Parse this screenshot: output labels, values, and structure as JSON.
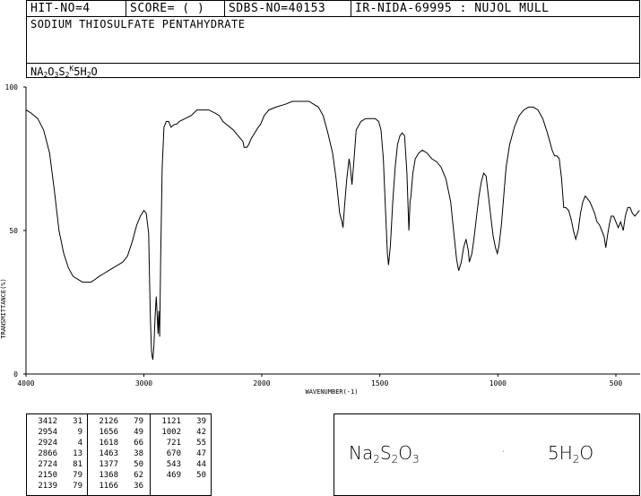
{
  "header": {
    "hit_no": "HIT-NO=4",
    "score": "SCORE=  (   )",
    "sdbs_no": "SDBS-NO=40153",
    "ir_nida": "IR-NIDA-69995 : NUJOL MULL",
    "compound_name": "SODIUM THIOSULFATE PENTAHYDRATE",
    "formula_parts": [
      "NA",
      "2",
      "O",
      "3",
      "S",
      "2",
      "K",
      "5H",
      "2",
      "O"
    ]
  },
  "chart_data": {
    "type": "line",
    "title": "",
    "xlabel": "WAVENUMBER(-1)",
    "ylabel": "TRANSMITTANCE(%)",
    "xlim": [
      4000,
      400
    ],
    "ylim": [
      0,
      100
    ],
    "x_ticks": [
      "4000",
      "3000",
      "2000",
      "1500",
      "1000",
      "500"
    ],
    "x_tick_values": [
      4000,
      3000,
      2000,
      1500,
      1000,
      500
    ],
    "y_ticks": [
      "0",
      "50",
      "100"
    ],
    "y_tick_values": [
      0,
      50,
      100
    ],
    "series": [
      {
        "points": [
          [
            4000,
            92
          ],
          [
            3960,
            91
          ],
          [
            3900,
            89
          ],
          [
            3850,
            85
          ],
          [
            3800,
            77
          ],
          [
            3760,
            64
          ],
          [
            3720,
            50
          ],
          [
            3680,
            42
          ],
          [
            3640,
            37
          ],
          [
            3600,
            34
          ],
          [
            3560,
            33
          ],
          [
            3520,
            32
          ],
          [
            3480,
            32
          ],
          [
            3450,
            32
          ],
          [
            3412,
            33
          ],
          [
            3380,
            34
          ],
          [
            3340,
            35
          ],
          [
            3300,
            36
          ],
          [
            3260,
            37
          ],
          [
            3220,
            38
          ],
          [
            3180,
            39
          ],
          [
            3140,
            41
          ],
          [
            3100,
            46
          ],
          [
            3060,
            52
          ],
          [
            3030,
            55
          ],
          [
            3000,
            57
          ],
          [
            2980,
            56
          ],
          [
            2960,
            49
          ],
          [
            2954,
            38
          ],
          [
            2945,
            20
          ],
          [
            2935,
            8
          ],
          [
            2929,
            6
          ],
          [
            2924,
            5
          ],
          [
            2915,
            10
          ],
          [
            2905,
            20
          ],
          [
            2895,
            27
          ],
          [
            2887,
            20
          ],
          [
            2880,
            14
          ],
          [
            2874,
            22
          ],
          [
            2866,
            13
          ],
          [
            2858,
            40
          ],
          [
            2845,
            72
          ],
          [
            2830,
            86
          ],
          [
            2810,
            88
          ],
          [
            2790,
            88
          ],
          [
            2770,
            86
          ],
          [
            2740,
            87
          ],
          [
            2724,
            87
          ],
          [
            2700,
            88
          ],
          [
            2650,
            89
          ],
          [
            2600,
            90
          ],
          [
            2550,
            92
          ],
          [
            2500,
            92
          ],
          [
            2450,
            92
          ],
          [
            2400,
            91
          ],
          [
            2360,
            90
          ],
          [
            2330,
            88
          ],
          [
            2300,
            87
          ],
          [
            2270,
            86
          ],
          [
            2240,
            85
          ],
          [
            2220,
            84
          ],
          [
            2200,
            83
          ],
          [
            2180,
            82
          ],
          [
            2160,
            81
          ],
          [
            2150,
            79
          ],
          [
            2139,
            79
          ],
          [
            2126,
            79
          ],
          [
            2110,
            80
          ],
          [
            2090,
            82
          ],
          [
            2060,
            84
          ],
          [
            2030,
            86
          ],
          [
            2010,
            87
          ],
          [
            1990,
            90
          ],
          [
            1970,
            92
          ],
          [
            1940,
            93
          ],
          [
            1900,
            94
          ],
          [
            1870,
            95
          ],
          [
            1850,
            95
          ],
          [
            1820,
            95
          ],
          [
            1800,
            95
          ],
          [
            1780,
            94
          ],
          [
            1760,
            93
          ],
          [
            1740,
            90
          ],
          [
            1720,
            84
          ],
          [
            1700,
            77
          ],
          [
            1685,
            68
          ],
          [
            1670,
            56
          ],
          [
            1660,
            53
          ],
          [
            1656,
            51
          ],
          [
            1650,
            58
          ],
          [
            1640,
            68
          ],
          [
            1630,
            75
          ],
          [
            1625,
            72
          ],
          [
            1618,
            66
          ],
          [
            1610,
            74
          ],
          [
            1600,
            85
          ],
          [
            1580,
            88
          ],
          [
            1560,
            89
          ],
          [
            1540,
            89
          ],
          [
            1520,
            89
          ],
          [
            1505,
            88
          ],
          [
            1495,
            85
          ],
          [
            1485,
            75
          ],
          [
            1475,
            55
          ],
          [
            1468,
            42
          ],
          [
            1463,
            38
          ],
          [
            1455,
            45
          ],
          [
            1445,
            60
          ],
          [
            1435,
            72
          ],
          [
            1425,
            80
          ],
          [
            1415,
            83
          ],
          [
            1405,
            84
          ],
          [
            1395,
            83
          ],
          [
            1385,
            70
          ],
          [
            1377,
            50
          ],
          [
            1372,
            60
          ],
          [
            1368,
            62
          ],
          [
            1360,
            70
          ],
          [
            1350,
            75
          ],
          [
            1335,
            77
          ],
          [
            1320,
            78
          ],
          [
            1300,
            77
          ],
          [
            1280,
            75
          ],
          [
            1260,
            74
          ],
          [
            1240,
            72
          ],
          [
            1220,
            68
          ],
          [
            1200,
            60
          ],
          [
            1185,
            48
          ],
          [
            1175,
            40
          ],
          [
            1166,
            36
          ],
          [
            1155,
            39
          ],
          [
            1145,
            44
          ],
          [
            1135,
            47
          ],
          [
            1125,
            43
          ],
          [
            1121,
            39
          ],
          [
            1110,
            42
          ],
          [
            1100,
            48
          ],
          [
            1090,
            55
          ],
          [
            1080,
            62
          ],
          [
            1070,
            67
          ],
          [
            1060,
            70
          ],
          [
            1050,
            69
          ],
          [
            1040,
            62
          ],
          [
            1030,
            55
          ],
          [
            1020,
            48
          ],
          [
            1010,
            44
          ],
          [
            1002,
            42
          ],
          [
            995,
            45
          ],
          [
            985,
            52
          ],
          [
            975,
            62
          ],
          [
            965,
            72
          ],
          [
            950,
            80
          ],
          [
            930,
            86
          ],
          [
            910,
            90
          ],
          [
            890,
            92
          ],
          [
            870,
            93
          ],
          [
            850,
            93
          ],
          [
            830,
            92
          ],
          [
            810,
            89
          ],
          [
            790,
            84
          ],
          [
            770,
            78
          ],
          [
            760,
            76
          ],
          [
            750,
            76
          ],
          [
            740,
            75
          ],
          [
            730,
            68
          ],
          [
            721,
            58
          ],
          [
            712,
            58
          ],
          [
            700,
            57
          ],
          [
            690,
            54
          ],
          [
            680,
            50
          ],
          [
            670,
            47
          ],
          [
            660,
            50
          ],
          [
            650,
            56
          ],
          [
            640,
            60
          ],
          [
            630,
            62
          ],
          [
            620,
            61
          ],
          [
            610,
            60
          ],
          [
            600,
            58
          ],
          [
            590,
            56
          ],
          [
            580,
            53
          ],
          [
            570,
            52
          ],
          [
            560,
            50
          ],
          [
            550,
            48
          ],
          [
            543,
            44
          ],
          [
            536,
            48
          ],
          [
            528,
            52
          ],
          [
            520,
            55
          ],
          [
            510,
            55
          ],
          [
            500,
            53
          ],
          [
            490,
            51
          ],
          [
            480,
            53
          ],
          [
            469,
            50
          ],
          [
            460,
            55
          ],
          [
            450,
            58
          ],
          [
            440,
            58
          ],
          [
            430,
            56
          ],
          [
            420,
            55
          ],
          [
            410,
            56
          ],
          [
            400,
            57
          ]
        ]
      }
    ]
  },
  "peak_table": [
    [
      [
        "3412",
        "31"
      ],
      [
        "2954",
        "9"
      ],
      [
        "2924",
        "4"
      ],
      [
        "2866",
        "13"
      ],
      [
        "2724",
        "81"
      ],
      [
        "2150",
        "79"
      ],
      [
        "2139",
        "79"
      ]
    ],
    [
      [
        "2126",
        "79"
      ],
      [
        "1656",
        "49"
      ],
      [
        "1618",
        "66"
      ],
      [
        "1463",
        "38"
      ],
      [
        "1377",
        "50"
      ],
      [
        "1368",
        "62"
      ],
      [
        "1166",
        "36"
      ]
    ],
    [
      [
        "1121",
        "39"
      ],
      [
        "1002",
        "42"
      ],
      [
        "721",
        "55"
      ],
      [
        "670",
        "47"
      ],
      [
        "543",
        "44"
      ],
      [
        "469",
        "50"
      ]
    ]
  ],
  "structure": {
    "left_parts": [
      "Na",
      "2",
      "S",
      "2",
      "O",
      "3"
    ],
    "dot": "·",
    "right_parts": [
      "5H",
      "2",
      "O"
    ]
  },
  "colors": {
    "line": "#000000",
    "background": "#ffffff"
  }
}
